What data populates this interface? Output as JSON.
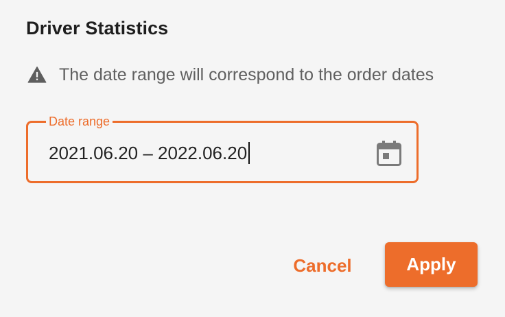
{
  "dialog": {
    "title": "Driver Statistics",
    "notice": {
      "icon": "warning-icon",
      "text": "The date range will correspond to the order dates"
    },
    "date_field": {
      "label": "Date range",
      "value": "2021.06.20 – 2022.06.20",
      "icon": "calendar-icon"
    },
    "actions": {
      "cancel_label": "Cancel",
      "apply_label": "Apply"
    }
  },
  "colors": {
    "accent": "#ed6d2b",
    "background": "#f5f5f5",
    "title_text": "#1e1e1e",
    "notice_text": "#606060",
    "icon_gray": "#616161"
  }
}
